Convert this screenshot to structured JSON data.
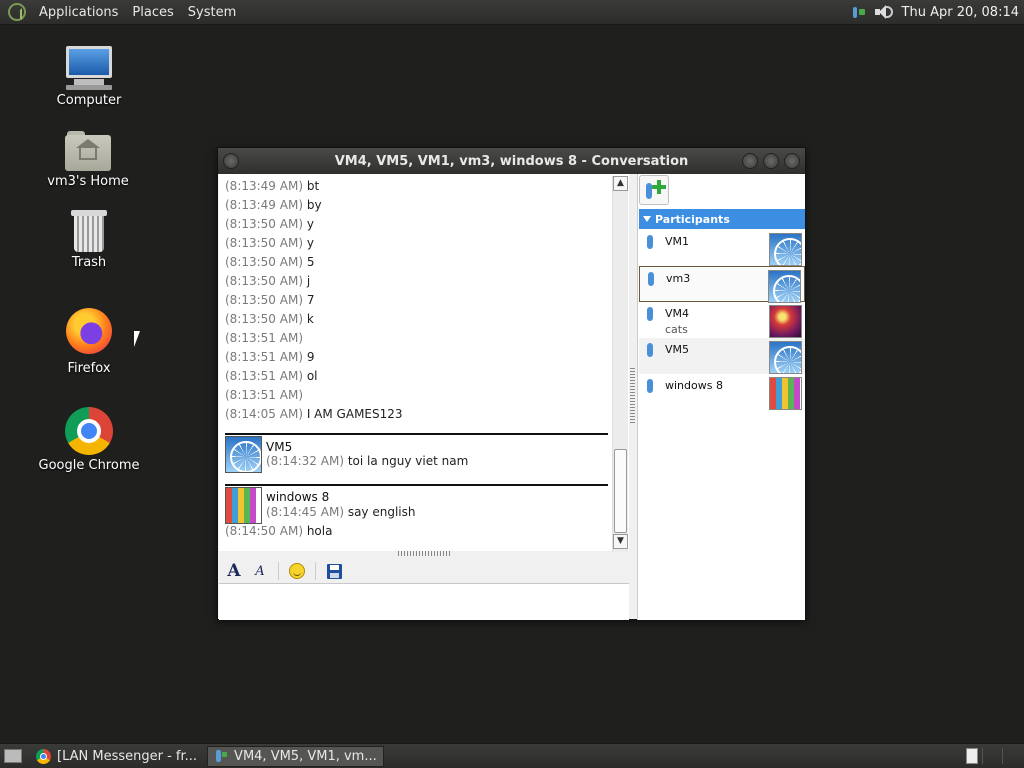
{
  "top_panel": {
    "menus": [
      "Applications",
      "Places",
      "System"
    ],
    "clock": "Thu Apr 20, 08:14"
  },
  "desktop_icons": [
    {
      "label": "Computer",
      "icon": "computer-icon"
    },
    {
      "label": "vm3's Home",
      "icon": "home-folder-icon"
    },
    {
      "label": "Trash",
      "icon": "trash-icon"
    },
    {
      "label": "Firefox",
      "icon": "firefox-icon"
    },
    {
      "label": "Google Chrome",
      "icon": "chrome-icon"
    }
  ],
  "window": {
    "title": "VM4, VM5, VM1, vm3, windows 8 - Conversation",
    "messages": [
      {
        "time": "(8:13:49 AM)",
        "text": "bt"
      },
      {
        "time": "(8:13:49 AM)",
        "text": "by"
      },
      {
        "time": "(8:13:50 AM)",
        "text": "y"
      },
      {
        "time": "(8:13:50 AM)",
        "text": "y"
      },
      {
        "time": "(8:13:50 AM)",
        "text": "5"
      },
      {
        "time": "(8:13:50 AM)",
        "text": "j"
      },
      {
        "time": "(8:13:50 AM)",
        "text": "7"
      },
      {
        "time": "(8:13:50 AM)",
        "text": "k"
      },
      {
        "time": "(8:13:51 AM)",
        "text": ""
      },
      {
        "time": "(8:13:51 AM)",
        "text": "9"
      },
      {
        "time": "(8:13:51 AM)",
        "text": "ol"
      },
      {
        "time": "(8:13:51 AM)",
        "text": ""
      },
      {
        "time": "(8:14:05 AM)",
        "text": "I AM GAMES123"
      }
    ],
    "blocks": [
      {
        "sender": "VM5",
        "avatar": "ferris-wheel",
        "messages": [
          {
            "time": "(8:14:32 AM)",
            "text": "toi la nguy viet nam"
          }
        ]
      },
      {
        "sender": "windows 8",
        "avatar": "crayons",
        "messages": [
          {
            "time": "(8:14:45 AM)",
            "text": "say english"
          },
          {
            "time": "(8:14:50 AM)",
            "text": "hola"
          }
        ]
      }
    ],
    "participants_header": "Participants",
    "participants": [
      {
        "name": "VM1",
        "status": "",
        "avatar": "ferris-wheel"
      },
      {
        "name": "vm3",
        "status": "",
        "avatar": "ferris-wheel"
      },
      {
        "name": "VM4",
        "status": "cats",
        "avatar": "ball"
      },
      {
        "name": "VM5",
        "status": "",
        "avatar": "ferris-wheel"
      },
      {
        "name": "windows 8",
        "status": "",
        "avatar": "crayons"
      }
    ]
  },
  "taskbar": {
    "tasks": [
      {
        "label": "[LAN Messenger - fr...",
        "icon": "chrome-icon",
        "active": false
      },
      {
        "label": "VM4, VM5, VM1, vm...",
        "icon": "messenger-icon",
        "active": true
      }
    ]
  }
}
